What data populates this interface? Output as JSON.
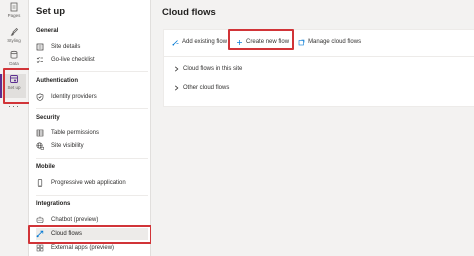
{
  "rail": {
    "items": [
      {
        "label": "Pages"
      },
      {
        "label": "Styling"
      },
      {
        "label": "Data"
      },
      {
        "label": "Set up"
      }
    ],
    "more": "···"
  },
  "panel": {
    "title": "Set up",
    "sections": [
      {
        "heading": "General",
        "items": [
          {
            "label": "Site details"
          },
          {
            "label": "Go-live checklist"
          }
        ]
      },
      {
        "heading": "Authentication",
        "items": [
          {
            "label": "Identity providers"
          }
        ]
      },
      {
        "heading": "Security",
        "items": [
          {
            "label": "Table permissions"
          },
          {
            "label": "Site visibility"
          }
        ]
      },
      {
        "heading": "Mobile",
        "items": [
          {
            "label": "Progressive web application"
          }
        ]
      },
      {
        "heading": "Integrations",
        "items": [
          {
            "label": "Chatbot (preview)"
          },
          {
            "label": "Cloud flows"
          },
          {
            "label": "External apps (preview)"
          }
        ]
      }
    ]
  },
  "main": {
    "title": "Cloud flows",
    "toolbar": {
      "add_existing": "Add existing flow",
      "create_new": "Create new flow",
      "manage": "Manage cloud flows"
    },
    "groups": [
      {
        "label": "Cloud flows in this site"
      },
      {
        "label": "Other cloud flows"
      }
    ]
  },
  "colors": {
    "accent": "#5c2e91",
    "highlight": "#d13438",
    "link_blue": "#0078d4"
  }
}
